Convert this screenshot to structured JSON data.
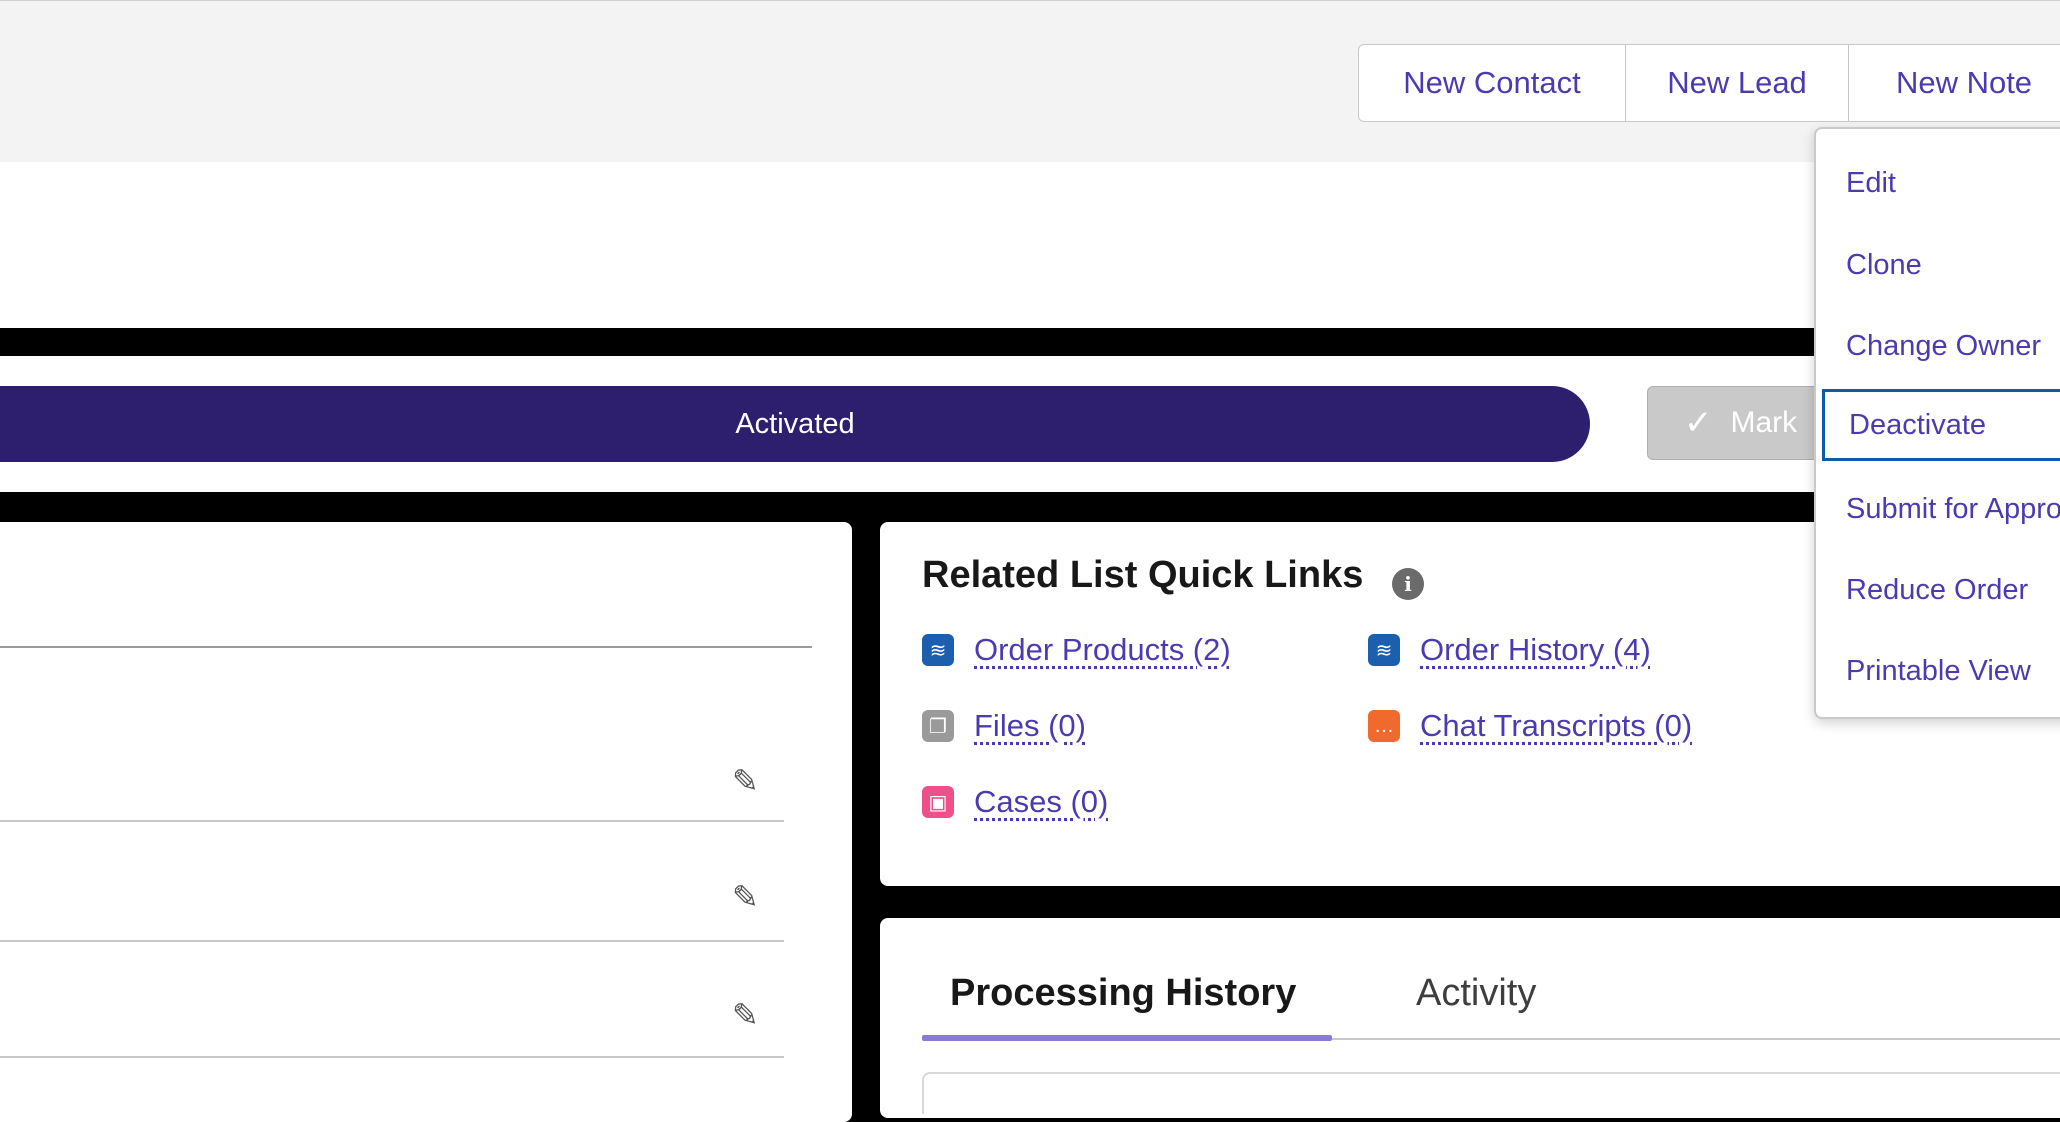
{
  "header": {
    "buttons": [
      {
        "label": "New Contact"
      },
      {
        "label": "New Lead"
      },
      {
        "label": "New Note"
      }
    ]
  },
  "path": {
    "current_stage": "Activated",
    "mark_button_label": "Mark"
  },
  "actions_menu": {
    "items": [
      {
        "label": "Edit"
      },
      {
        "label": "Clone"
      },
      {
        "label": "Change Owner"
      },
      {
        "label": "Deactivate",
        "focused": true
      },
      {
        "label": "Submit for Appro"
      },
      {
        "label": "Reduce Order"
      },
      {
        "label": "Printable View"
      }
    ]
  },
  "related_quick_links": {
    "title": "Related List Quick Links",
    "info_icon": "info-icon",
    "links": [
      {
        "label": "Order Products (2)",
        "icon": "order-products-icon",
        "color": "#1b5fae"
      },
      {
        "label": "Order History (4)",
        "icon": "order-history-icon",
        "color": "#1b5fae"
      },
      {
        "label": "Files (0)",
        "icon": "files-icon",
        "color": "#9a9a9a"
      },
      {
        "label": "Chat Transcripts (0)",
        "icon": "chat-transcripts-icon",
        "color": "#f06a2d"
      },
      {
        "label": "Cases (0)",
        "icon": "cases-icon",
        "color": "#f0508a"
      }
    ]
  },
  "tabs": [
    {
      "label": "Processing History",
      "active": true
    },
    {
      "label": "Activity",
      "active": false
    }
  ],
  "colors": {
    "brand_dark": "#2e1f6e",
    "link": "#4b3bb1",
    "focus_ring": "#0b5cab",
    "tab_indicator": "#8b7bd8"
  }
}
